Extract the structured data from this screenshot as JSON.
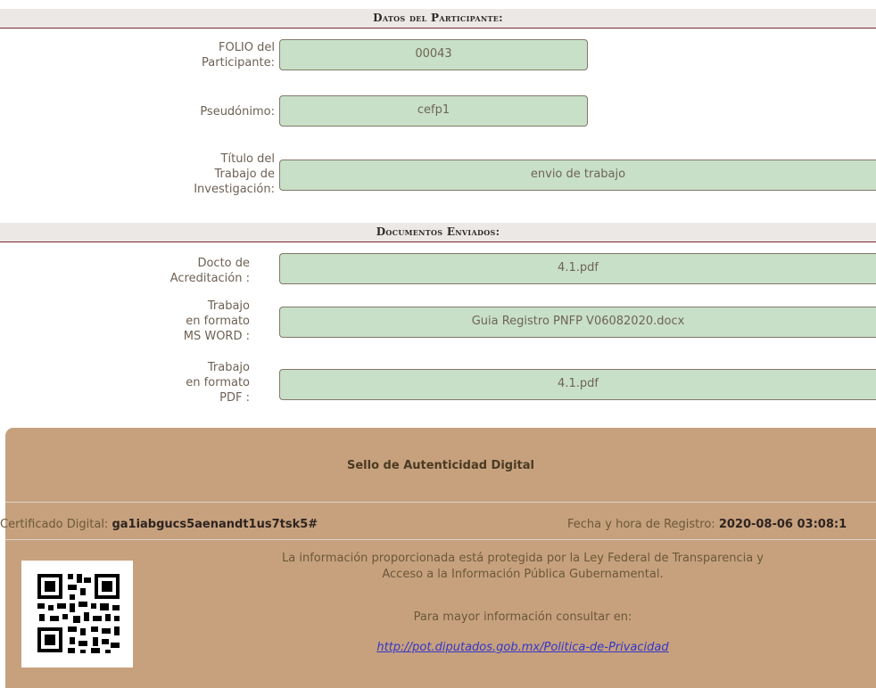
{
  "participant_section": {
    "title": "Datos del Participante:",
    "folio": {
      "label_line1": "FOLIO del",
      "label_line2": "Participante:",
      "value": "00043"
    },
    "pseudonimo": {
      "label": "Pseudónimo:",
      "value": "cefp1"
    },
    "titulo": {
      "label_line1": "Título del",
      "label_line2": "Trabajo de",
      "label_line3": "Investigación:",
      "value": "envio de trabajo"
    }
  },
  "documents_section": {
    "title": "Documentos Enviados:",
    "acreditacion": {
      "label_line1": "Docto de",
      "label_line2": "Acreditación :",
      "value": "4.1.pdf"
    },
    "word": {
      "label_line1": "Trabajo",
      "label_line2": "en formato",
      "label_line3": "MS WORD :",
      "value": "Guia Registro PNFP V06082020.docx"
    },
    "pdf": {
      "label_line1": "Trabajo",
      "label_line2": "en formato",
      "label_line3": "PDF :",
      "value": "4.1.pdf"
    }
  },
  "seal": {
    "title": "Sello de Autenticidad Digital",
    "cert_label": "Certificado Digital:",
    "cert_value": "ga1iabgucs5aenandt1us7tsk5#",
    "fecha_label": "Fecha y hora de Registro:",
    "fecha_value": "2020-08-06 03:08:1",
    "legal_line1": "La información proporcionada está protegida por la Ley Federal de Transparencia y",
    "legal_line2": "Acceso a la Información Pública Gubernamental.",
    "more_info": "Para mayor información consultar en:",
    "privacy_link": "http://pot.diputados.gob.mx/Politica-de-Privacidad"
  },
  "colors": {
    "field_bg": "#c8e0c8",
    "header_rule": "#7a2a30",
    "seal_bg": "#c7a17e",
    "link": "#3436c8"
  }
}
